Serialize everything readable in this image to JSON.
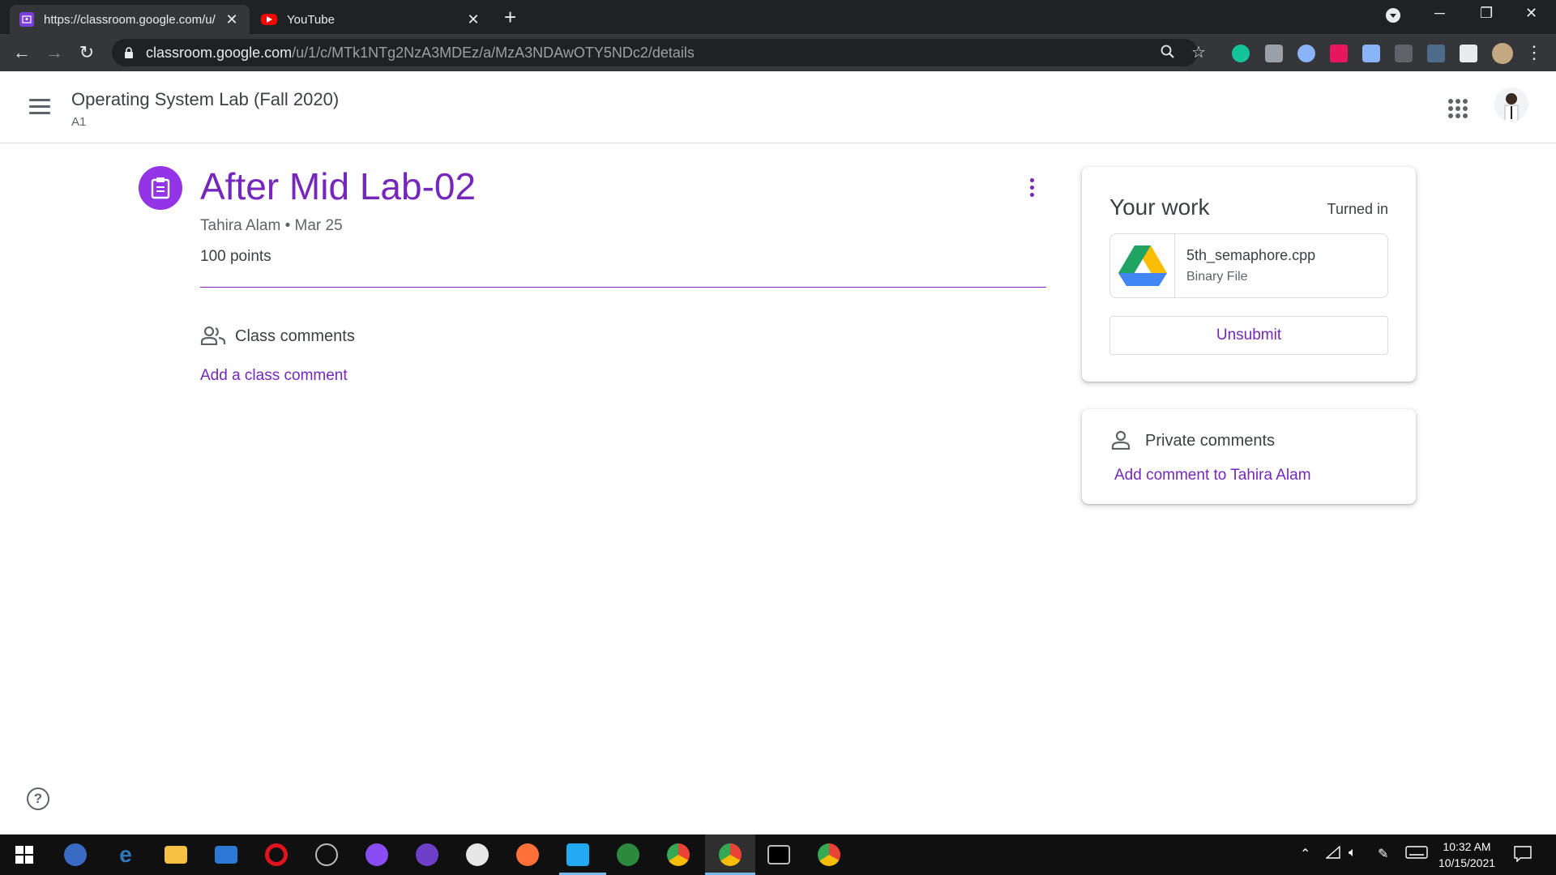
{
  "browser": {
    "tabs": [
      {
        "title": "https://classroom.google.com/u/",
        "active": true
      },
      {
        "title": "YouTube",
        "active": false
      }
    ],
    "new_tab_label": "+",
    "url_host": "classroom.google.com",
    "url_path": "/u/1/c/MTk1NTg2NzA3MDEz/a/MzA3NDAwOTY5NDc2/details"
  },
  "header": {
    "class_name": "Operating System Lab (Fall 2020)",
    "section": "A1"
  },
  "assignment": {
    "title": "After Mid Lab-02",
    "author": "Tahira Alam",
    "separator": "•",
    "date": "Mar 25",
    "points": "100 points"
  },
  "class_comments": {
    "label": "Class comments",
    "add_link": "Add a class comment"
  },
  "your_work": {
    "title": "Your work",
    "status": "Turned in",
    "file_name": "5th_semaphore.cpp",
    "file_type": "Binary File",
    "unsubmit_label": "Unsubmit"
  },
  "private_comments": {
    "label": "Private comments",
    "add_link": "Add comment to Tahira Alam"
  },
  "help_label": "?",
  "taskbar": {
    "time": "10:32 AM",
    "date": "10/15/2021"
  },
  "colors": {
    "accent": "#7627bb",
    "assignment_icon_bg": "#9334e6",
    "chrome_dark": "#202124",
    "chrome_toolbar": "#35363a"
  }
}
